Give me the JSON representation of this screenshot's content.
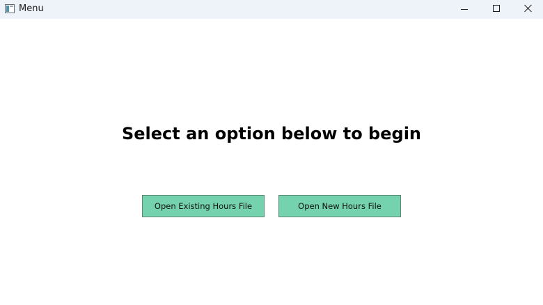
{
  "window": {
    "title": "Menu",
    "icon": "app-window-icon"
  },
  "titlebar_controls": {
    "minimize_icon": "minimize-icon",
    "maximize_icon": "maximize-icon",
    "close_icon": "close-icon"
  },
  "main": {
    "heading": "Select an option below to begin",
    "buttons": [
      {
        "label": "Open Existing Hours File"
      },
      {
        "label": "Open New Hours File"
      }
    ]
  },
  "colors": {
    "button_background": "#74d2ae",
    "titlebar_background": "#eef2f9"
  }
}
